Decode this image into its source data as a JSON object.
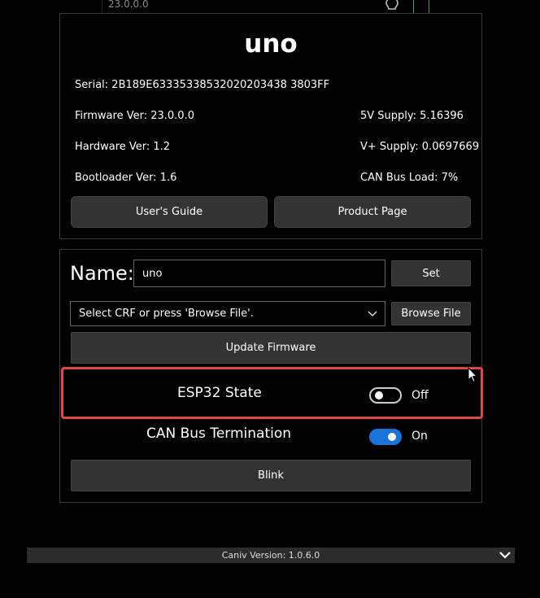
{
  "top": {
    "text": "23.0.0.0"
  },
  "device": {
    "title": "uno",
    "serial": "Serial: 2B189E63335338532020203438 3803FF",
    "firmware": "Firmware Ver: 23.0.0.0",
    "hardware": "Hardware Ver: 1.2",
    "bootloader": "Bootloader Ver: 1.6",
    "supply5v": "5V Supply: 5.16396",
    "supplyVplus": "V+ Supply: 0.0697669",
    "canLoad": "CAN Bus Load: 7%"
  },
  "buttons": {
    "users_guide": "User's Guide",
    "product_page": "Product Page",
    "set": "Set",
    "browse": "Browse File",
    "update": "Update Firmware",
    "blink": "Blink"
  },
  "name": {
    "label": "Name:",
    "value": "uno"
  },
  "crf": {
    "placeholder": "Select CRF or press 'Browse File'."
  },
  "toggles": [
    {
      "label": "ESP32 State",
      "state": "Off",
      "on": false
    },
    {
      "label": "CAN Bus Termination",
      "state": "On",
      "on": true
    }
  ],
  "footer": {
    "text": "Caniv Version:  1.0.6.0"
  },
  "colors": {
    "highlight": "#e04848",
    "toggle_on": "#1a73d9"
  },
  "icons": [
    "lightbulb-icon",
    "chevron-down-icon",
    "cursor-icon"
  ]
}
